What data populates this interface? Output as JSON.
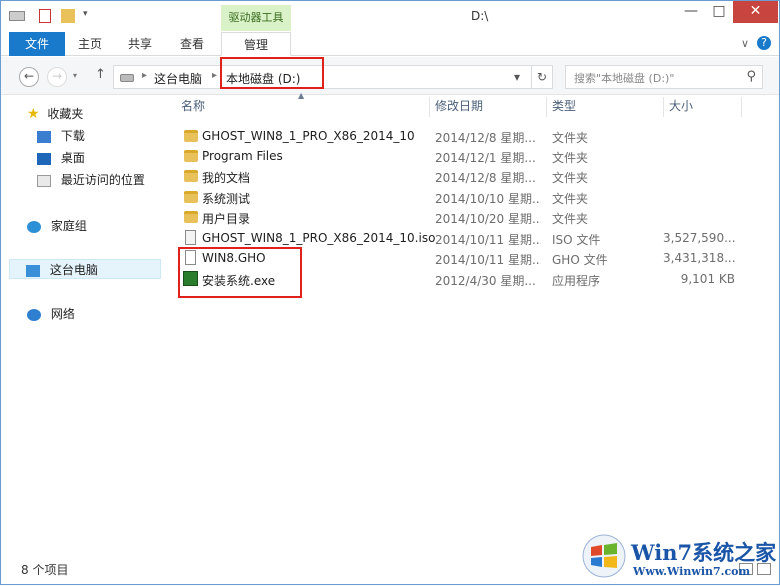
{
  "window": {
    "title": "D:\\",
    "contextual_tab_group": "驱动器工具",
    "minimize": "—",
    "maximize": "□",
    "close": "✕"
  },
  "ribbon": {
    "tabs": [
      {
        "label": "文件"
      },
      {
        "label": "主页"
      },
      {
        "label": "共享"
      },
      {
        "label": "查看"
      },
      {
        "label": "管理"
      }
    ],
    "expand_glyph": "∨",
    "help_glyph": "?"
  },
  "address": {
    "back": "←",
    "forward": "→",
    "up": "↑",
    "segment_1": "这台电脑",
    "separator": "▸",
    "segment_2": "本地磁盘 (D:)",
    "dropdown": "▾",
    "refresh": "↻",
    "search_placeholder": "搜索\"本地磁盘 (D:)\"",
    "search_glyph": "⚲"
  },
  "navpane": {
    "favorites": "收藏夹",
    "downloads": "下载",
    "desktop": "桌面",
    "recent": "最近访问的位置",
    "homegroup": "家庭组",
    "this_pc": "这台电脑",
    "network": "网络"
  },
  "columns": {
    "name": "名称",
    "date": "修改日期",
    "type": "类型",
    "size": "大小"
  },
  "files": [
    {
      "name": "GHOST_WIN8_1_PRO_X86_2014_10",
      "date": "2014/12/8 星期...",
      "type": "文件夹",
      "size": "",
      "kind": "folder"
    },
    {
      "name": "Program Files",
      "date": "2014/12/1 星期...",
      "type": "文件夹",
      "size": "",
      "kind": "folder"
    },
    {
      "name": "我的文档",
      "date": "2014/12/8 星期...",
      "type": "文件夹",
      "size": "",
      "kind": "folder"
    },
    {
      "name": "系统测试",
      "date": "2014/10/10 星期...",
      "type": "文件夹",
      "size": "",
      "kind": "folder"
    },
    {
      "name": "用户目录",
      "date": "2014/10/20 星期...",
      "type": "文件夹",
      "size": "",
      "kind": "folder"
    },
    {
      "name": "GHOST_WIN8_1_PRO_X86_2014_10.iso",
      "date": "2014/10/11 星期...",
      "type": "ISO 文件",
      "size": "3,527,590...",
      "kind": "iso"
    },
    {
      "name": "WIN8.GHO",
      "date": "2014/10/11 星期...",
      "type": "GHO 文件",
      "size": "3,431,318...",
      "kind": "file"
    },
    {
      "name": "安装系统.exe",
      "date": "2012/4/30 星期...",
      "type": "应用程序",
      "size": "9,101 KB",
      "kind": "exe"
    }
  ],
  "status": {
    "item_count": "8 个项目"
  },
  "watermark": {
    "title": "Win7系统之家",
    "url": "Www.Winwin7.com"
  },
  "colors": {
    "file_tab": "#1979ca",
    "context_tab": "#d9f2c7",
    "highlight_box": "#e0201b",
    "selected_nav": "#e5f3fb"
  }
}
